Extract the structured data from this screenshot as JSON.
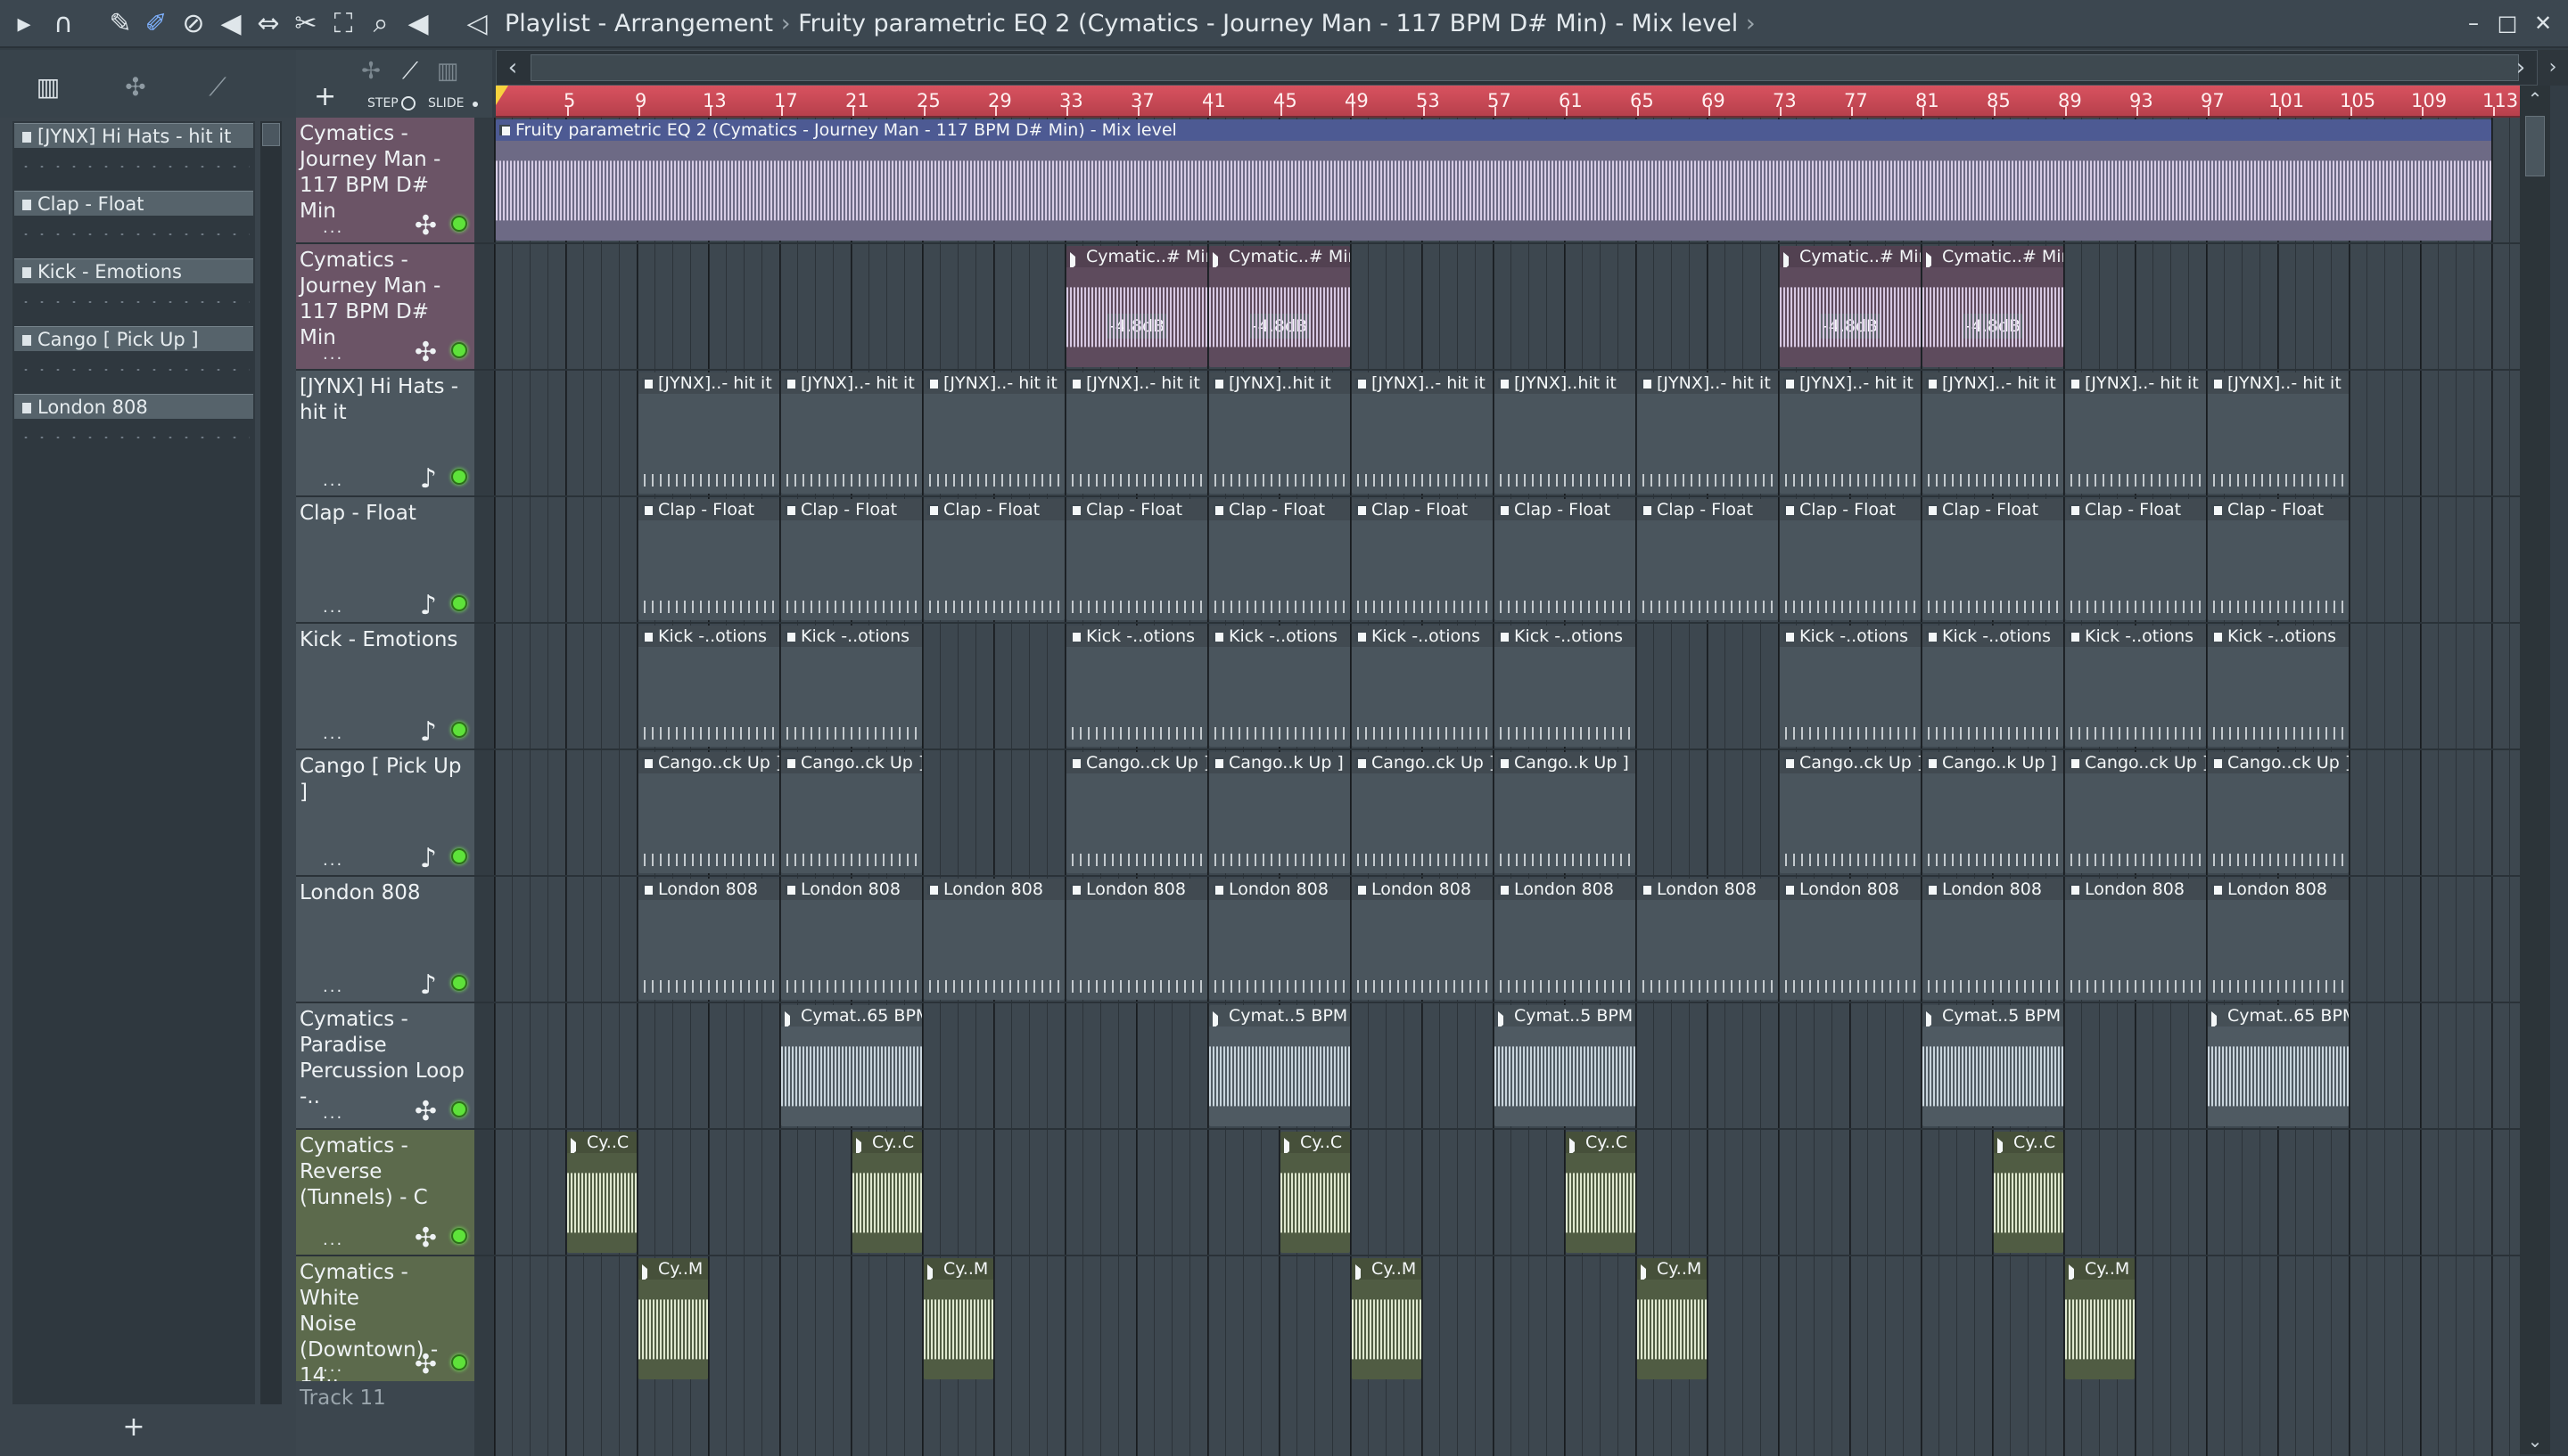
{
  "titlebar": {
    "title_primary": "Playlist - Arrangement",
    "separator": "›",
    "title_secondary": "Fruity parametric EQ 2 (Cymatics - Journey Man - 117 BPM D# Min) - Mix level",
    "arrow": "›",
    "minimize": "–",
    "maximize": "□",
    "close": "✕"
  },
  "toolbar": {
    "step_label": "STEP",
    "slide_label": "SLIDE",
    "add_track": "+"
  },
  "picker": {
    "add_button": "+",
    "items": [
      {
        "label": "[JYNX] Hi Hats - hit it"
      },
      {
        "label": "Clap - Float"
      },
      {
        "label": "Kick - Emotions"
      },
      {
        "label": "Cango [ Pick Up ]"
      },
      {
        "label": "London 808"
      }
    ]
  },
  "ruler": {
    "bars": [
      "5",
      "9",
      "13",
      "17",
      "21",
      "25",
      "29",
      "33",
      "37",
      "41",
      "45",
      "49",
      "53",
      "57",
      "61",
      "65",
      "69",
      "73",
      "77",
      "81",
      "85",
      "89",
      "93",
      "97",
      "101",
      "105",
      "109",
      "113"
    ]
  },
  "colors": {
    "ruler": "#c8475a",
    "led": "#5ee23a",
    "playhead": "#f7d23e"
  },
  "tracks": [
    {
      "name": "Cymatics -\nJourney Man -\n117 BPM D# Min",
      "dots": "...",
      "icon": "✣",
      "header_color": "#6b5466",
      "clips": [
        {
          "label": "Fruity parametric EQ 2 (Cymatics - Journey Man - 117 BPM D# Min) - Mix level",
          "start": 0,
          "len": 112,
          "kind": "auto",
          "color": "#556099",
          "wave": "#d7cde6"
        }
      ]
    },
    {
      "name": "Cymatics -\nJourney Man -\n117 BPM D# Min",
      "dots": "...",
      "icon": "✣",
      "header_color": "#6b5466",
      "clips": [
        {
          "label": "Cymatic..# Min",
          "start": 32,
          "len": 8,
          "kind": "aud",
          "color": "#5e4b5d",
          "wave": "#d7c8e2",
          "badge": "-4.8dB"
        },
        {
          "label": "Cymatic..# Min",
          "start": 40,
          "len": 8,
          "kind": "aud",
          "color": "#5e4b5d",
          "wave": "#d7c8e2",
          "badge": "-4.8dB"
        },
        {
          "label": "Cymatic..# Min",
          "start": 72,
          "len": 8,
          "kind": "aud",
          "color": "#5e4b5d",
          "wave": "#d7c8e2",
          "badge": "-4.8dB"
        },
        {
          "label": "Cymatic..# Min",
          "start": 80,
          "len": 8,
          "kind": "aud",
          "color": "#5e4b5d",
          "wave": "#d7c8e2",
          "badge": "-4.8dB"
        }
      ]
    },
    {
      "name": "[JYNX] Hi Hats -\nhit it",
      "dots": "...",
      "icon": "♪",
      "header_color": "#4c575f",
      "clips": [
        {
          "label": "[JYNX]..- hit it",
          "start": 8,
          "len": 8,
          "kind": "pat",
          "color": "#4a555d"
        },
        {
          "label": "[JYNX]..- hit it",
          "start": 16,
          "len": 8,
          "kind": "pat",
          "color": "#4a555d"
        },
        {
          "label": "[JYNX]..- hit it",
          "start": 24,
          "len": 8,
          "kind": "pat",
          "color": "#4a555d"
        },
        {
          "label": "[JYNX]..- hit it",
          "start": 32,
          "len": 8,
          "kind": "pat",
          "color": "#4a555d"
        },
        {
          "label": "[JYNX]..hit it",
          "start": 40,
          "len": 8,
          "kind": "pat",
          "color": "#4a555d"
        },
        {
          "label": "[JYNX]..- hit it",
          "start": 48,
          "len": 8,
          "kind": "pat",
          "color": "#4a555d"
        },
        {
          "label": "[JYNX]..hit it",
          "start": 56,
          "len": 8,
          "kind": "pat",
          "color": "#4a555d"
        },
        {
          "label": "[JYNX]..- hit it",
          "start": 64,
          "len": 8,
          "kind": "pat",
          "color": "#4a555d"
        },
        {
          "label": "[JYNX]..- hit it",
          "start": 72,
          "len": 8,
          "kind": "pat",
          "color": "#4a555d"
        },
        {
          "label": "[JYNX]..- hit it",
          "start": 80,
          "len": 8,
          "kind": "pat",
          "color": "#4a555d"
        },
        {
          "label": "[JYNX]..- hit it",
          "start": 88,
          "len": 8,
          "kind": "pat",
          "color": "#4a555d"
        },
        {
          "label": "[JYNX]..- hit it",
          "start": 96,
          "len": 8,
          "kind": "pat",
          "color": "#4a555d"
        }
      ]
    },
    {
      "name": "Clap - Float",
      "dots": "...",
      "icon": "♪",
      "header_color": "#4c575f",
      "clips": [
        {
          "label": "Clap - Float",
          "start": 8,
          "len": 8,
          "kind": "pat",
          "color": "#4a555d"
        },
        {
          "label": "Clap - Float",
          "start": 16,
          "len": 8,
          "kind": "pat",
          "color": "#4a555d"
        },
        {
          "label": "Clap - Float",
          "start": 24,
          "len": 8,
          "kind": "pat",
          "color": "#4a555d"
        },
        {
          "label": "Clap - Float",
          "start": 32,
          "len": 8,
          "kind": "pat",
          "color": "#4a555d"
        },
        {
          "label": "Clap - Float",
          "start": 40,
          "len": 8,
          "kind": "pat",
          "color": "#4a555d"
        },
        {
          "label": "Clap - Float",
          "start": 48,
          "len": 8,
          "kind": "pat",
          "color": "#4a555d"
        },
        {
          "label": "Clap - Float",
          "start": 56,
          "len": 8,
          "kind": "pat",
          "color": "#4a555d"
        },
        {
          "label": "Clap - Float",
          "start": 64,
          "len": 8,
          "kind": "pat",
          "color": "#4a555d"
        },
        {
          "label": "Clap - Float",
          "start": 72,
          "len": 8,
          "kind": "pat",
          "color": "#4a555d"
        },
        {
          "label": "Clap - Float",
          "start": 80,
          "len": 8,
          "kind": "pat",
          "color": "#4a555d"
        },
        {
          "label": "Clap - Float",
          "start": 88,
          "len": 8,
          "kind": "pat",
          "color": "#4a555d"
        },
        {
          "label": "Clap - Float",
          "start": 96,
          "len": 8,
          "kind": "pat",
          "color": "#4a555d"
        }
      ]
    },
    {
      "name": "Kick - Emotions",
      "dots": "...",
      "icon": "♪",
      "header_color": "#4c575f",
      "clips": [
        {
          "label": "Kick -..otions",
          "start": 8,
          "len": 8,
          "kind": "pat",
          "color": "#4a555d"
        },
        {
          "label": "Kick -..otions",
          "start": 16,
          "len": 8,
          "kind": "pat",
          "color": "#4a555d"
        },
        {
          "label": "Kick -..otions",
          "start": 32,
          "len": 8,
          "kind": "pat",
          "color": "#4a555d"
        },
        {
          "label": "Kick -..otions",
          "start": 40,
          "len": 8,
          "kind": "pat",
          "color": "#4a555d"
        },
        {
          "label": "Kick -..otions",
          "start": 48,
          "len": 8,
          "kind": "pat",
          "color": "#4a555d"
        },
        {
          "label": "Kick -..otions",
          "start": 56,
          "len": 8,
          "kind": "pat",
          "color": "#4a555d"
        },
        {
          "label": "Kick -..otions",
          "start": 72,
          "len": 8,
          "kind": "pat",
          "color": "#4a555d"
        },
        {
          "label": "Kick -..otions",
          "start": 80,
          "len": 8,
          "kind": "pat",
          "color": "#4a555d"
        },
        {
          "label": "Kick -..otions",
          "start": 88,
          "len": 8,
          "kind": "pat",
          "color": "#4a555d"
        },
        {
          "label": "Kick -..otions",
          "start": 96,
          "len": 8,
          "kind": "pat",
          "color": "#4a555d"
        }
      ]
    },
    {
      "name": "Cango [ Pick Up ]",
      "dots": "...",
      "icon": "♪",
      "header_color": "#4c575f",
      "clips": [
        {
          "label": "Cango..ck Up ]",
          "start": 8,
          "len": 8,
          "kind": "pat",
          "color": "#4a555d"
        },
        {
          "label": "Cango..ck Up ]",
          "start": 16,
          "len": 8,
          "kind": "pat",
          "color": "#4a555d"
        },
        {
          "label": "Cango..ck Up ]",
          "start": 32,
          "len": 8,
          "kind": "pat",
          "color": "#4a555d"
        },
        {
          "label": "Cango..k Up ]",
          "start": 40,
          "len": 8,
          "kind": "pat",
          "color": "#4a555d"
        },
        {
          "label": "Cango..ck Up ]",
          "start": 48,
          "len": 8,
          "kind": "pat",
          "color": "#4a555d"
        },
        {
          "label": "Cango..k Up ]",
          "start": 56,
          "len": 8,
          "kind": "pat",
          "color": "#4a555d"
        },
        {
          "label": "Cango..ck Up ]",
          "start": 72,
          "len": 8,
          "kind": "pat",
          "color": "#4a555d"
        },
        {
          "label": "Cango..k Up ]",
          "start": 80,
          "len": 8,
          "kind": "pat",
          "color": "#4a555d"
        },
        {
          "label": "Cango..ck Up ]",
          "start": 88,
          "len": 8,
          "kind": "pat",
          "color": "#4a555d"
        },
        {
          "label": "Cango..ck Up ]",
          "start": 96,
          "len": 8,
          "kind": "pat",
          "color": "#4a555d"
        }
      ]
    },
    {
      "name": "London 808",
      "dots": "...",
      "icon": "♪",
      "header_color": "#4c575f",
      "clips": [
        {
          "label": "London 808",
          "start": 8,
          "len": 8,
          "kind": "pat",
          "color": "#4a555d"
        },
        {
          "label": "London 808",
          "start": 16,
          "len": 8,
          "kind": "pat",
          "color": "#4a555d"
        },
        {
          "label": "London 808",
          "start": 24,
          "len": 8,
          "kind": "pat",
          "color": "#4a555d"
        },
        {
          "label": "London 808",
          "start": 32,
          "len": 8,
          "kind": "pat",
          "color": "#4a555d"
        },
        {
          "label": "London 808",
          "start": 40,
          "len": 8,
          "kind": "pat",
          "color": "#4a555d"
        },
        {
          "label": "London 808",
          "start": 48,
          "len": 8,
          "kind": "pat",
          "color": "#4a555d"
        },
        {
          "label": "London 808",
          "start": 56,
          "len": 8,
          "kind": "pat",
          "color": "#4a555d"
        },
        {
          "label": "London 808",
          "start": 64,
          "len": 8,
          "kind": "pat",
          "color": "#4a555d"
        },
        {
          "label": "London 808",
          "start": 72,
          "len": 8,
          "kind": "pat",
          "color": "#4a555d"
        },
        {
          "label": "London 808",
          "start": 80,
          "len": 8,
          "kind": "pat",
          "color": "#4a555d"
        },
        {
          "label": "London 808",
          "start": 88,
          "len": 8,
          "kind": "pat",
          "color": "#4a555d"
        },
        {
          "label": "London 808",
          "start": 96,
          "len": 8,
          "kind": "pat",
          "color": "#4a555d"
        }
      ]
    },
    {
      "name": "Cymatics -\nParadise\nPercussion Loop -..",
      "dots": "...",
      "icon": "✣",
      "header_color": "#4f5a62",
      "clips": [
        {
          "label": "Cymat..65 BPM",
          "start": 16,
          "len": 8,
          "kind": "aud",
          "color": "#4f5a62",
          "wave": "#c9d5dd"
        },
        {
          "label": "Cymat..5 BPM",
          "start": 40,
          "len": 8,
          "kind": "aud",
          "color": "#4f5a62",
          "wave": "#c9d5dd"
        },
        {
          "label": "Cymat..5 BPM",
          "start": 56,
          "len": 8,
          "kind": "aud",
          "color": "#4f5a62",
          "wave": "#c9d5dd"
        },
        {
          "label": "Cymat..5 BPM",
          "start": 80,
          "len": 8,
          "kind": "aud",
          "color": "#4f5a62",
          "wave": "#c9d5dd"
        },
        {
          "label": "Cymat..65 BPM",
          "start": 96,
          "len": 8,
          "kind": "aud",
          "color": "#4f5a62",
          "wave": "#c9d5dd"
        }
      ]
    },
    {
      "name": "Cymatics -\nReverse\n(Tunnels) - C",
      "dots": "...",
      "icon": "✣",
      "header_color": "#5c6a4c",
      "clips": [
        {
          "label": "Cy..C",
          "start": 4,
          "len": 4,
          "kind": "aud",
          "color": "#505c43",
          "wave": "#dfe8cf"
        },
        {
          "label": "Cy..C",
          "start": 20,
          "len": 4,
          "kind": "aud",
          "color": "#505c43",
          "wave": "#dfe8cf"
        },
        {
          "label": "Cy..C",
          "start": 44,
          "len": 4,
          "kind": "aud",
          "color": "#505c43",
          "wave": "#dfe8cf"
        },
        {
          "label": "Cy..C",
          "start": 60,
          "len": 4,
          "kind": "aud",
          "color": "#505c43",
          "wave": "#dfe8cf"
        },
        {
          "label": "Cy..C",
          "start": 84,
          "len": 4,
          "kind": "aud",
          "color": "#505c43",
          "wave": "#dfe8cf"
        }
      ]
    },
    {
      "name": "Cymatics - White\nNoise\n(Downtown) - 14..",
      "dots": "...",
      "icon": "✣",
      "header_color": "#5c6a4c",
      "clips": [
        {
          "label": "Cy..M",
          "start": 8,
          "len": 4,
          "kind": "aud",
          "color": "#505c43",
          "wave": "#dfe8cf"
        },
        {
          "label": "Cy..M",
          "start": 24,
          "len": 4,
          "kind": "aud",
          "color": "#505c43",
          "wave": "#dfe8cf"
        },
        {
          "label": "Cy..M",
          "start": 48,
          "len": 4,
          "kind": "aud",
          "color": "#505c43",
          "wave": "#dfe8cf"
        },
        {
          "label": "Cy..M",
          "start": 64,
          "len": 4,
          "kind": "aud",
          "color": "#505c43",
          "wave": "#dfe8cf"
        },
        {
          "label": "Cy..M",
          "start": 88,
          "len": 4,
          "kind": "aud",
          "color": "#505c43",
          "wave": "#dfe8cf"
        }
      ]
    }
  ],
  "track11": {
    "name": "Track 11"
  }
}
